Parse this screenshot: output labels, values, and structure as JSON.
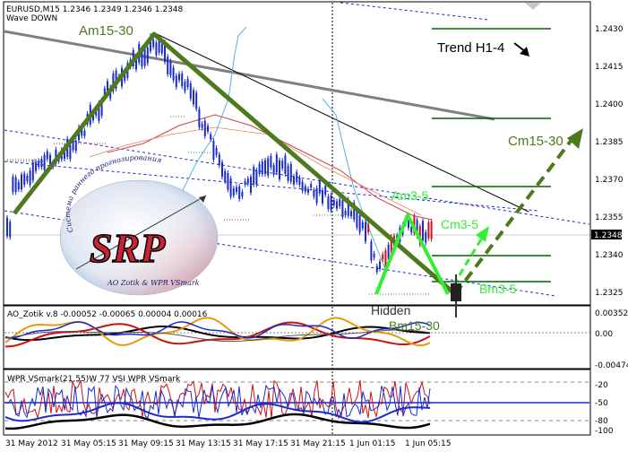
{
  "main_panel": {
    "symbol_line": "EURUSD,M15  1.2346 1.2349 1.2346 1.2348",
    "indicator_line": "Wave DOWN",
    "price_labels": [
      "1.2430",
      "1.2415",
      "1.2400",
      "1.2385",
      "1.2370",
      "1.2355",
      "1.2340",
      "1.2325"
    ],
    "current_price": "1.2348",
    "annotations": {
      "am15_30": "Am15-30",
      "trend_h1_4": "Trend H1-4",
      "cm15_30": "Cm15-30",
      "am3_5": "Am3-5",
      "cm3_5": "Cm3-5",
      "bm3_5": "Bm3-5",
      "hidden": "Hidden",
      "bm15_30": "Bm15-30"
    },
    "logo": {
      "arc_text": "Система раннего прогнозирования",
      "big_text": "SRP",
      "authors": "AO Zotik & WPR VSmark"
    },
    "colors": {
      "wave_line": "#4e7a1e",
      "bright_line": "#33ee33",
      "candles": "#1a2bcc",
      "candle_red": "#cc1122",
      "trend_gray": "#808080",
      "level_green": "#006400"
    }
  },
  "ao_panel": {
    "title": "AO_Zotik v.8 -0.00052 -0.00065 0.00004 0.00016",
    "price_labels": [
      "0.00352",
      "0.00",
      "-0.00474"
    ]
  },
  "wpr_panel": {
    "title": "WPR VSmark(21,55)W 77 VSI WPR VSmark",
    "price_labels": [
      "-20",
      "-50",
      "-80",
      "-100"
    ]
  },
  "time_axis": [
    "31 May 2012",
    "31 May 05:15",
    "31 May 09:15",
    "31 May 13:15",
    "31 May 17:15",
    "31 May 21:15",
    "1 Jun 01:15",
    "1 Jun 05:15"
  ]
}
